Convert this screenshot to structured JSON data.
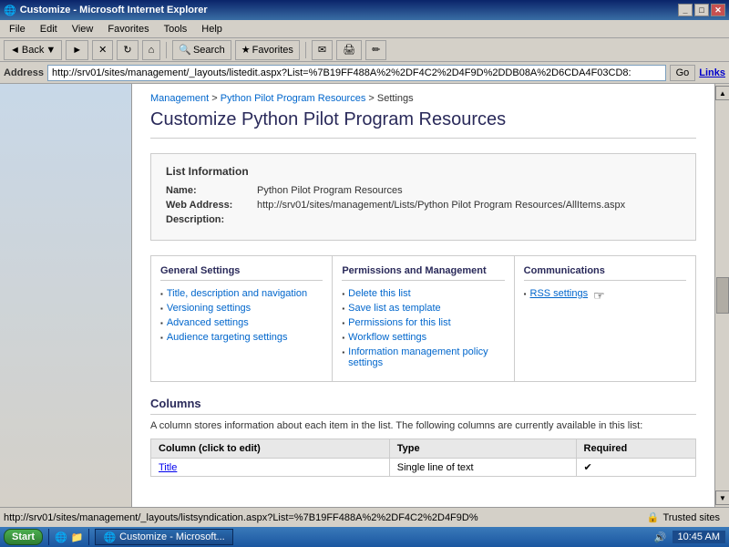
{
  "window": {
    "title": "Customize - Microsoft Internet Explorer",
    "titlebar_controls": [
      "_",
      "□",
      "✕"
    ]
  },
  "menubar": {
    "items": [
      "File",
      "Edit",
      "View",
      "Favorites",
      "Tools",
      "Help"
    ]
  },
  "toolbar": {
    "back_label": "Back",
    "search_label": "Search",
    "favorites_label": "Favorites",
    "links_label": "Links"
  },
  "address": {
    "label": "Address",
    "url": "http://srv01/sites/management/_layouts/listedit.aspx?List=%7B19FF488A%2%2DF4C2%2D4F9D%2DDB08A%2D6CDA4F03CD8:",
    "go_label": "Go",
    "links_label": "Links"
  },
  "breadcrumb": {
    "items": [
      "Management",
      "Python Pilot Program Resources",
      "Settings"
    ]
  },
  "page": {
    "title": "Customize Python Pilot Program Resources",
    "list_info": {
      "heading": "List Information",
      "name_label": "Name:",
      "name_value": "Python Pilot Program Resources",
      "web_address_label": "Web Address:",
      "web_address_value": "http://srv01/sites/management/Lists/Python Pilot Program Resources/AllItems.aspx",
      "description_label": "Description:"
    },
    "sections": [
      {
        "id": "general-settings",
        "heading": "General Settings",
        "items": [
          "Title, description and navigation",
          "Versioning settings",
          "Advanced settings",
          "Audience targeting settings"
        ]
      },
      {
        "id": "permissions-management",
        "heading": "Permissions and Management",
        "items": [
          "Delete this list",
          "Save list as template",
          "Permissions for this list",
          "Workflow settings",
          "Information management policy settings"
        ]
      },
      {
        "id": "communications",
        "heading": "Communications",
        "items": [
          "RSS settings"
        ]
      }
    ],
    "columns": {
      "heading": "Columns",
      "description": "A column stores information about each item in the list. The following columns are currently available in this list:",
      "headers": [
        "Column (click to edit)",
        "Type",
        "Required"
      ],
      "rows": [
        [
          "Title",
          "Single line of text",
          "✔"
        ]
      ]
    }
  },
  "statusbar": {
    "url": "http://srv01/sites/management/_layouts/listsyndication.aspx?List=%7B19FF488A%2%2DF4C2%2D4F9D%",
    "trusted_label": "Trusted sites"
  },
  "taskbar": {
    "start_label": "Start",
    "apps": [
      "Customize - Microsoft..."
    ],
    "time": "10:45 AM"
  }
}
